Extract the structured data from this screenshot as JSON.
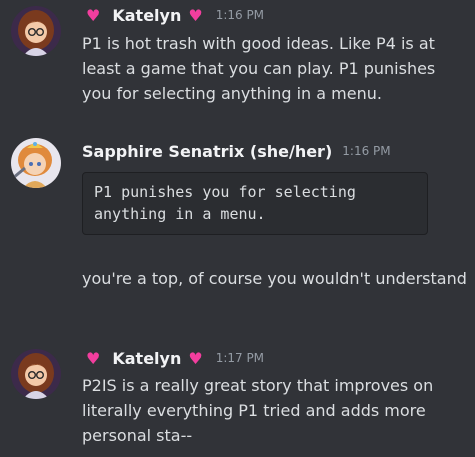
{
  "messages": [
    {
      "author": "Katelyn",
      "timestamp": "1:16 PM",
      "text": "P1 is hot trash with good ideas. Like P4 is at least a game that you can play. P1 punishes you for selecting anything in a menu."
    },
    {
      "author": "Sapphire Senatrix (she/her)",
      "timestamp": "1:16 PM",
      "quote": "P1 punishes you for selecting anything in a menu.",
      "text": "you're a top, of course you wouldn't understand"
    },
    {
      "author": "Katelyn",
      "timestamp": "1:17 PM",
      "text": "P2IS is a really great story that improves on literally everything P1 tried and adds more personal sta--"
    }
  ],
  "icons": {
    "heart": "♥",
    "heart_color": "#f23e9e"
  }
}
